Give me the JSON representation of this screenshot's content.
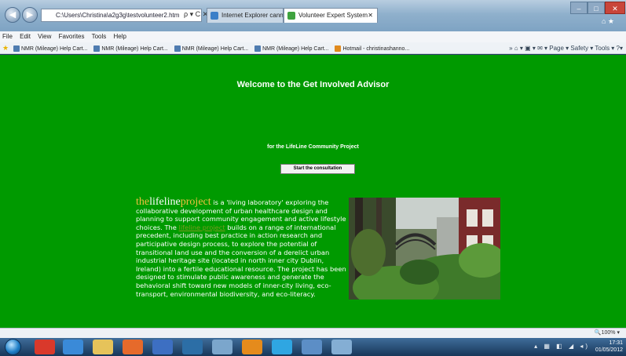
{
  "browser": {
    "address": "C:\\Users\\Christina\\a2g3g\\testvolunteer2.htm",
    "address_controls": "ρ ▾ C ✕",
    "tabs": [
      {
        "label": "Internet Explorer cannot displa..."
      },
      {
        "label": "Volunteer Expert System"
      }
    ],
    "tab_close": "✕",
    "window_controls": {
      "minimize": "–",
      "maximize": "□",
      "close": "✕"
    },
    "titlebar_right": "⌂ ★"
  },
  "menu": [
    "File",
    "Edit",
    "View",
    "Favorites",
    "Tools",
    "Help"
  ],
  "favorites": [
    "NMR (Mileage) Help Cart...",
    "NMR (Mileage) Help Cart...",
    "NMR (Mileage) Help Cart...",
    "NMR (Mileage) Help Cart...",
    "Hotmail - christinashanno..."
  ],
  "command_bar": "» ⌂ ▾ ▣ ▾ ✉ ▾ Page ▾ Safety ▾ Tools ▾ ?▾",
  "page": {
    "title": "Welcome to the Get Involved Advisor",
    "subtitle": "for the LifeLine Community Project",
    "start_button": "Start the consultation",
    "brand": {
      "part1": "the",
      "part2": "lifeline",
      "part3": "project"
    },
    "para_intro": " is a 'living laboratory' exploring the collaborative development of urban healthcare design and planning to support community engagement and active lifestyle choices. The ",
    "para_link": "lifeline project",
    "para_rest": " builds on a range of international precedent, including best practice in action research and participative design process, to explore the potential of transitional land use and the conversion of a derelict urban industrial heritage site (located in north inner city Dublin, Ireland) into a fertile educational resource. The project has been designed to stimulate public awareness and generate the behavioral shift toward new models of inner-city living, eco-transport, environmental biodiversity, and eco-literacy."
  },
  "status": {
    "zoom": "100%"
  },
  "taskbar": {
    "time": "17:31",
    "date": "01/05/2012"
  }
}
